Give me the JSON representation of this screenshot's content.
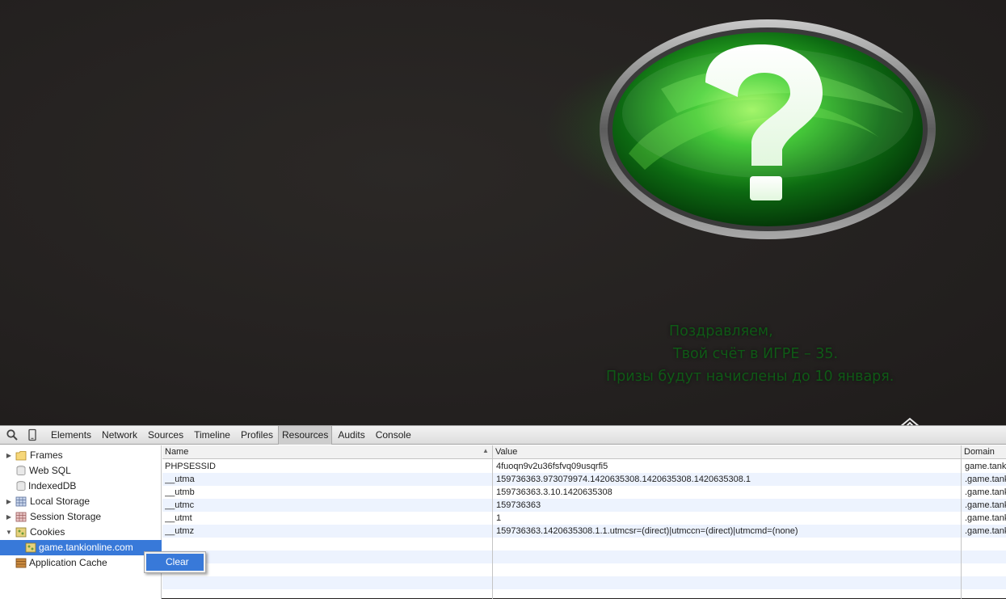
{
  "page": {
    "message_lines": [
      "Поздравляем,",
      "Твой счёт в ИГРЕ – 35.",
      "Призы будут начислены до 10 января."
    ],
    "emblem_icon": "question-mark-emblem-icon",
    "colors": {
      "background": "#242120",
      "message_text": "#0f5a16",
      "emblem_green": "#2fae32"
    }
  },
  "devtools": {
    "toolbar": {
      "icons": [
        "search-icon",
        "device-mode-icon"
      ],
      "tabs": [
        {
          "label": "Elements"
        },
        {
          "label": "Network"
        },
        {
          "label": "Sources"
        },
        {
          "label": "Timeline"
        },
        {
          "label": "Profiles"
        },
        {
          "label": "Resources",
          "active": true
        },
        {
          "label": "Audits"
        },
        {
          "label": "Console"
        }
      ]
    },
    "sidebar": {
      "items": [
        {
          "label": "Frames",
          "icon": "folder-icon",
          "expandable": true,
          "expanded": false
        },
        {
          "label": "Web SQL",
          "icon": "database-icon",
          "expandable": false
        },
        {
          "label": "IndexedDB",
          "icon": "database-icon",
          "expandable": false
        },
        {
          "label": "Local Storage",
          "icon": "storage-grid-icon",
          "expandable": true,
          "expanded": false
        },
        {
          "label": "Session Storage",
          "icon": "storage-grid-icon",
          "expandable": true,
          "expanded": false
        },
        {
          "label": "Cookies",
          "icon": "cookie-icon",
          "expandable": true,
          "expanded": true
        },
        {
          "label": "game.tankionline.com",
          "icon": "cookie-icon",
          "selected": true
        },
        {
          "label": "Application Cache",
          "icon": "app-cache-icon",
          "expandable": false
        }
      ]
    },
    "cookies_table": {
      "columns": [
        "Name",
        "Value",
        "Domain"
      ],
      "sorted_by": "Name",
      "rows": [
        {
          "name": "PHPSESSID",
          "value": "4fuoqn9v2u36fsfvq09usqrfi5",
          "domain": "game.tank"
        },
        {
          "name": "__utma",
          "value": "159736363.973079974.1420635308.1420635308.1420635308.1",
          "domain": ".game.tank"
        },
        {
          "name": "__utmb",
          "value": "159736363.3.10.1420635308",
          "domain": ".game.tank"
        },
        {
          "name": "__utmc",
          "value": "159736363",
          "domain": ".game.tank"
        },
        {
          "name": "__utmt",
          "value": "1",
          "domain": ".game.tank"
        },
        {
          "name": "__utmz",
          "value": "159736363.1420635308.1.1.utmcsr=(direct)|utmccn=(direct)|utmcmd=(none)",
          "domain": ".game.tank"
        }
      ]
    },
    "context_menu": {
      "items": [
        {
          "label": "Clear"
        }
      ]
    },
    "colors": {
      "selection": "#3879d9",
      "alt_row": "#edf3fe"
    }
  }
}
